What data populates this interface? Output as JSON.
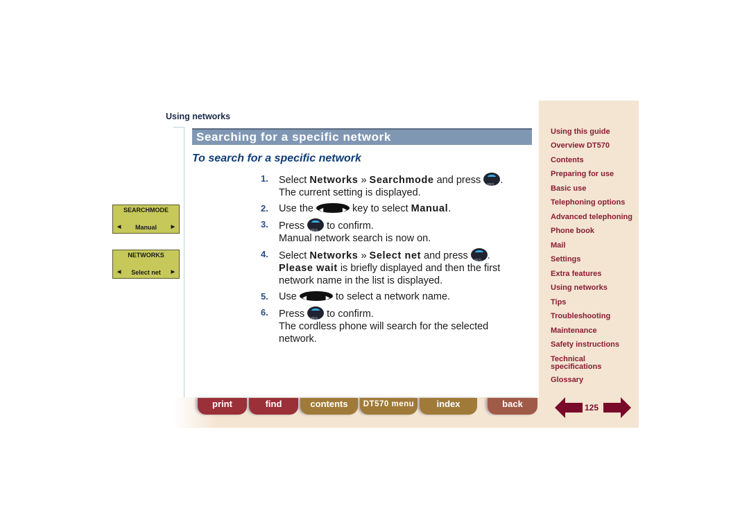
{
  "section_label": "Using networks",
  "title": "Searching for a specific network",
  "subtitle": "To search for a specific network",
  "steps": [
    {
      "num": "1.",
      "pre": "Select ",
      "b1": "Networks",
      "sep": " » ",
      "b2": "Searchmode",
      "post": " and press ",
      "end": ".",
      "line2": "The current setting is displayed."
    },
    {
      "num": "2.",
      "pre": "Use the ",
      "post": " key to select ",
      "b1": "Manual",
      "end": "."
    },
    {
      "num": "3.",
      "pre": "Press ",
      "post": " to confirm.",
      "line2": "Manual network search is now on."
    },
    {
      "num": "4.",
      "pre": "Select ",
      "b1": "Networks",
      "sep": " » ",
      "b2": "Select net",
      "post": " and press ",
      "end": ".",
      "b3": "Please wait",
      "line2": " is briefly displayed and then the first network name in the list is displayed."
    },
    {
      "num": "5.",
      "pre": "Use ",
      "post": " to select a network name."
    },
    {
      "num": "6.",
      "pre": "Press ",
      "post": " to confirm.",
      "line2": "The cordless phone will search for the selected network."
    }
  ],
  "lcd_displays": [
    {
      "header": "SEARCHMODE",
      "value": "Manual"
    },
    {
      "header": "NETWORKS",
      "value": "Select net"
    }
  ],
  "sidebar": {
    "items": [
      "Using this guide",
      "Overview DT570",
      "Contents",
      "Preparing for use",
      "Basic use",
      "Telephoning options",
      "Advanced telephoning",
      "Phone book",
      "Mail",
      "Settings",
      "Extra features",
      "Using networks",
      "Tips",
      "Troubleshooting",
      "Maintenance",
      "Safety instructions",
      "Technical specifications",
      "Glossary"
    ]
  },
  "bottom_nav": {
    "print": "print",
    "find": "find",
    "contents": "contents",
    "menu": "DT570 menu",
    "index": "index",
    "back": "back"
  },
  "page_number": "125",
  "colors": {
    "nav_text": "#8a1c34",
    "title_bar": "#8097b4",
    "arrow": "#7a0a2a"
  }
}
